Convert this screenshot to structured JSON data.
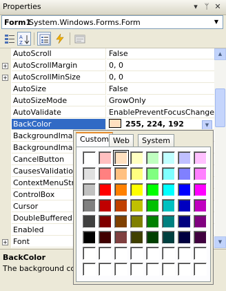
{
  "window": {
    "title": "Properties",
    "buttons": [
      "▾",
      "ᛘ",
      "✕"
    ]
  },
  "object_selector": {
    "name": "Form1",
    "type": "System.Windows.Forms.Form"
  },
  "toolbar": {
    "tools": [
      "categorized-icon",
      "alphabetical-icon",
      "properties-icon",
      "events-icon",
      "property-pages-icon"
    ]
  },
  "properties": [
    {
      "name": "AutoScroll",
      "value": "False",
      "expandable": false
    },
    {
      "name": "AutoScrollMargin",
      "value": "0, 0",
      "expandable": true
    },
    {
      "name": "AutoScrollMinSize",
      "value": "0, 0",
      "expandable": true
    },
    {
      "name": "AutoSize",
      "value": "False",
      "expandable": false
    },
    {
      "name": "AutoSizeMode",
      "value": "GrowOnly",
      "expandable": false
    },
    {
      "name": "AutoValidate",
      "value": "EnablePreventFocusChange",
      "expandable": false
    },
    {
      "name": "BackColor",
      "value": "255, 224, 192",
      "expandable": false,
      "selected": true,
      "swatch": "#ffe0c0"
    },
    {
      "name": "BackgroundImage",
      "value": "",
      "expandable": false
    },
    {
      "name": "BackgroundImageLayout",
      "value": "",
      "expandable": false
    },
    {
      "name": "CancelButton",
      "value": "",
      "expandable": false
    },
    {
      "name": "CausesValidation",
      "value": "",
      "expandable": false
    },
    {
      "name": "ContextMenuStrip",
      "value": "",
      "expandable": false
    },
    {
      "name": "ControlBox",
      "value": "",
      "expandable": false
    },
    {
      "name": "Cursor",
      "value": "",
      "expandable": false
    },
    {
      "name": "DoubleBuffered",
      "value": "",
      "expandable": false
    },
    {
      "name": "Enabled",
      "value": "",
      "expandable": false
    },
    {
      "name": "Font",
      "value": "",
      "expandable": true
    }
  ],
  "description": {
    "title": "BackColor",
    "text": "The background color"
  },
  "color_picker": {
    "tabs": [
      "Custom",
      "Web",
      "System"
    ],
    "active_tab": "Custom",
    "selected_color": "#ffe0c0",
    "rows": [
      [
        "#ffffff",
        "#ffc0c0",
        "#ffe0c0",
        "#ffffc0",
        "#c0ffc0",
        "#c0ffff",
        "#c0c0ff",
        "#ffc0ff"
      ],
      [
        "#e0e0e0",
        "#ff8080",
        "#ffc080",
        "#ffff80",
        "#80ff80",
        "#80ffff",
        "#8080ff",
        "#ff80ff"
      ],
      [
        "#c0c0c0",
        "#ff0000",
        "#ff8000",
        "#ffff00",
        "#00ff00",
        "#00ffff",
        "#0000ff",
        "#ff00ff"
      ],
      [
        "#808080",
        "#c00000",
        "#c04000",
        "#c0c000",
        "#00c000",
        "#00c0c0",
        "#0000c0",
        "#c000c0"
      ],
      [
        "#404040",
        "#800000",
        "#804000",
        "#808000",
        "#008000",
        "#008080",
        "#000080",
        "#800080"
      ],
      [
        "#000000",
        "#400000",
        "#804040",
        "#404000",
        "#004000",
        "#004040",
        "#000040",
        "#400040"
      ],
      [
        "#ffffff",
        "#ffffff",
        "#ffffff",
        "#ffffff",
        "#ffffff",
        "#ffffff",
        "#ffffff",
        "#ffffff"
      ],
      [
        "#ffffff",
        "#ffffff",
        "#ffffff",
        "#ffffff",
        "#ffffff",
        "#ffffff",
        "#ffffff",
        "#ffffff"
      ]
    ]
  }
}
